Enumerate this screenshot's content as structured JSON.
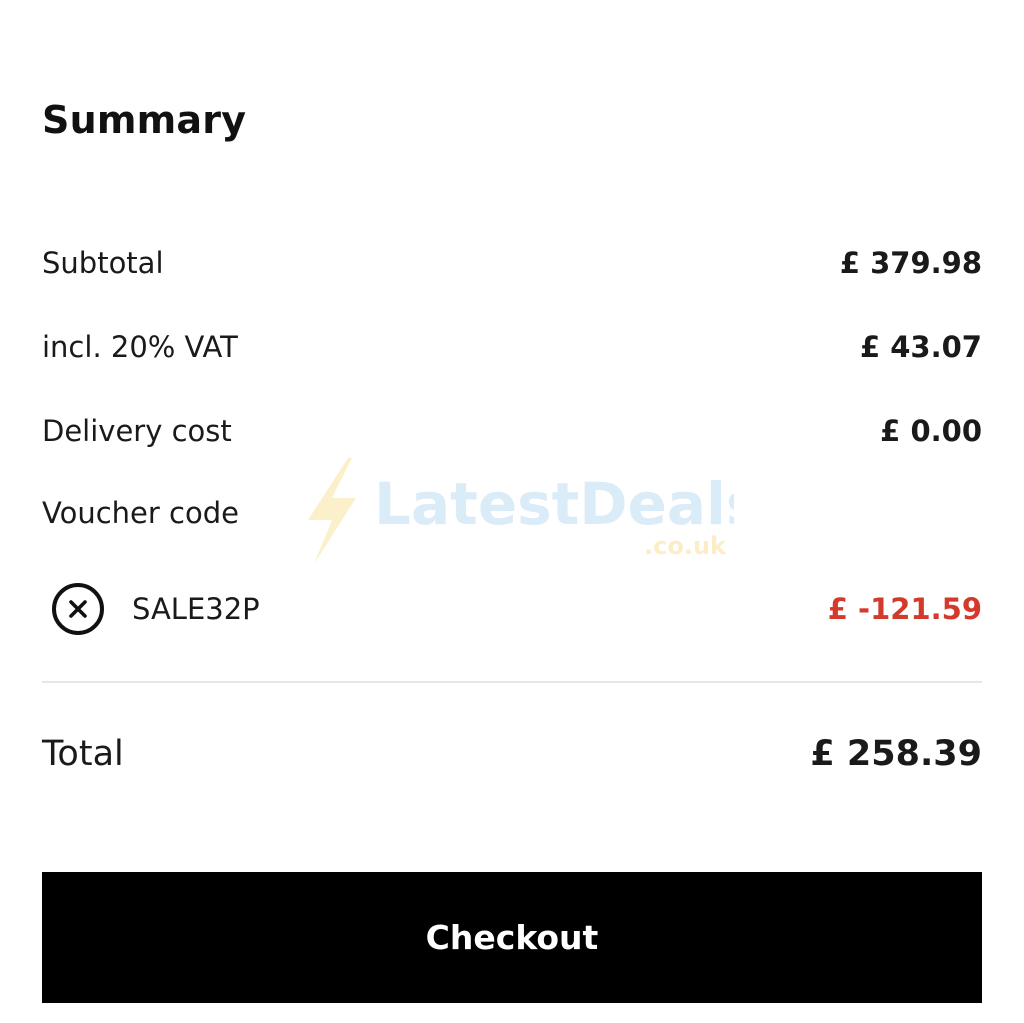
{
  "summary": {
    "title": "Summary"
  },
  "lines": {
    "subtotal": {
      "label": "Subtotal",
      "value": "£ 379.98"
    },
    "vat": {
      "label": "incl. 20% VAT",
      "value": "£ 43.07"
    },
    "delivery": {
      "label": "Delivery cost",
      "value": "£ 0.00"
    }
  },
  "voucher": {
    "heading": "Voucher code",
    "code": "SALE32P",
    "amount": "£ -121.59",
    "remove_icon": "close-circle-icon",
    "amount_color": "#d43a2c"
  },
  "total": {
    "label": "Total",
    "value": "£ 258.39"
  },
  "checkout": {
    "label": "Checkout"
  },
  "watermark": {
    "brand": "LatestDeals",
    "domain": ".co.uk"
  },
  "colors": {
    "text": "#111111",
    "discount": "#d43a2c",
    "button_bg": "#000000",
    "button_text": "#ffffff",
    "divider": "#e6e6e6"
  }
}
